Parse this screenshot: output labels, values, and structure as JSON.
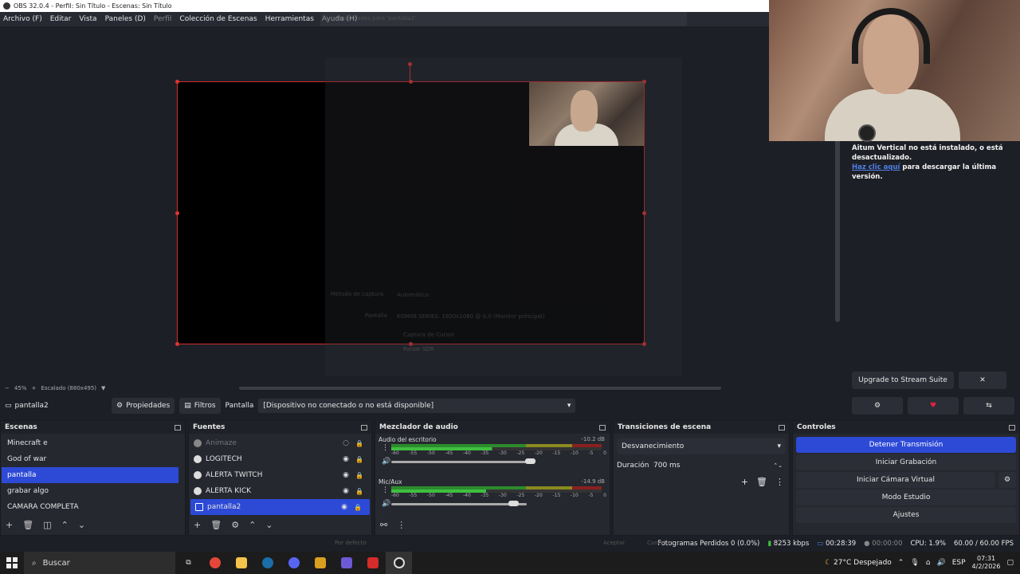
{
  "window": {
    "title": "OBS 32.0.4 - Perfil: Sin Título - Escenas: Sin Título"
  },
  "menu": {
    "items": [
      "Archivo (F)",
      "Editar",
      "Vista",
      "Paneles (D)",
      "Perfil",
      "Colección de Escenas",
      "Herramientas",
      "Ayuda (H)"
    ]
  },
  "ghost_dialog": {
    "title": "Propiedades para 'pantalla2'",
    "capture_method_label": "Método de captura",
    "capture_method_value": "Automático",
    "screen_label": "Pantalla",
    "screen_value": "KGM08 SERIES: 1920x1080 @ 0,0 (Monitor principal)",
    "cursor_label": "Captura de Cursor",
    "sdr_label": "Forzar SDR",
    "defaults_label": "Por defecto",
    "accept_label": "Aceptar",
    "cancel_label": "Cancelar"
  },
  "plugin": {
    "msg_line1": "Aitum Vertical no está instalado, o está desactualizado.",
    "link": "Haz clic aquí",
    "msg_line2": " para descargar la última versión."
  },
  "zoom": {
    "out": "−",
    "percent": "45%",
    "in": "+",
    "scale": "Escalado (880x495)",
    "arrow": "▼"
  },
  "stream_suite": {
    "upgrade": "Upgrade to Stream Suite",
    "close": "✕"
  },
  "source_bar": {
    "current_source": "pantalla2",
    "properties": "Propiedades",
    "filters": "Filtros",
    "screen_label": "Pantalla",
    "screen_value": "[Dispositivo no conectado o no está disponible]"
  },
  "scenes": {
    "title": "Escenas",
    "items": [
      "Minecraft e",
      "God of war",
      "pantalla",
      "grabar algo",
      "CAMARA COMPLETA"
    ],
    "selected": "pantalla"
  },
  "sources": {
    "title": "Fuentes",
    "items": [
      {
        "label": "Animaze",
        "visible": false
      },
      {
        "label": "LOGITECH",
        "visible": true
      },
      {
        "label": "ALERTA TWITCH",
        "visible": true
      },
      {
        "label": "ALERTA KICK",
        "visible": true
      },
      {
        "label": "pantalla2",
        "visible": true
      }
    ]
  },
  "mixer": {
    "title": "Mezclador de audio",
    "channels": [
      {
        "name": "Audio del escritorio",
        "db": "-10.2 dB",
        "volume": 0.97
      },
      {
        "name": "Mic/Aux",
        "db": "-14.9 dB",
        "volume": 0.72
      }
    ],
    "ticks": [
      "-60",
      "-55",
      "-50",
      "-45",
      "-40",
      "-35",
      "-30",
      "-25",
      "-20",
      "-15",
      "-10",
      "-5",
      "0"
    ]
  },
  "transitions": {
    "title": "Transiciones de escena",
    "selected": "Desvanecimiento",
    "duration_label": "Duración",
    "duration_value": "700 ms"
  },
  "controls": {
    "title": "Controles",
    "buttons": [
      "Detener Transmisión",
      "Iniciar Grabación",
      "Iniciar Cámara Virtual",
      "Modo Estudio",
      "Ajustes"
    ]
  },
  "status": {
    "dropped": "Fotogramas Perdidos 0 (0.0%)",
    "bitrate": "8253 kbps",
    "stream_time": "00:28:39",
    "rec_time": "00:00:00",
    "cpu": "CPU: 1.9%",
    "fps": "60.00 / 60.00 FPS"
  },
  "taskbar": {
    "search": "Buscar",
    "weather": "27°C  Despejado",
    "lang": "ESP",
    "time": "07:31",
    "date": "4/2/2026"
  },
  "colors": {
    "accent": "#2d4ad6",
    "selection_border": "#d42b2b",
    "bg": "#1d1f26"
  }
}
